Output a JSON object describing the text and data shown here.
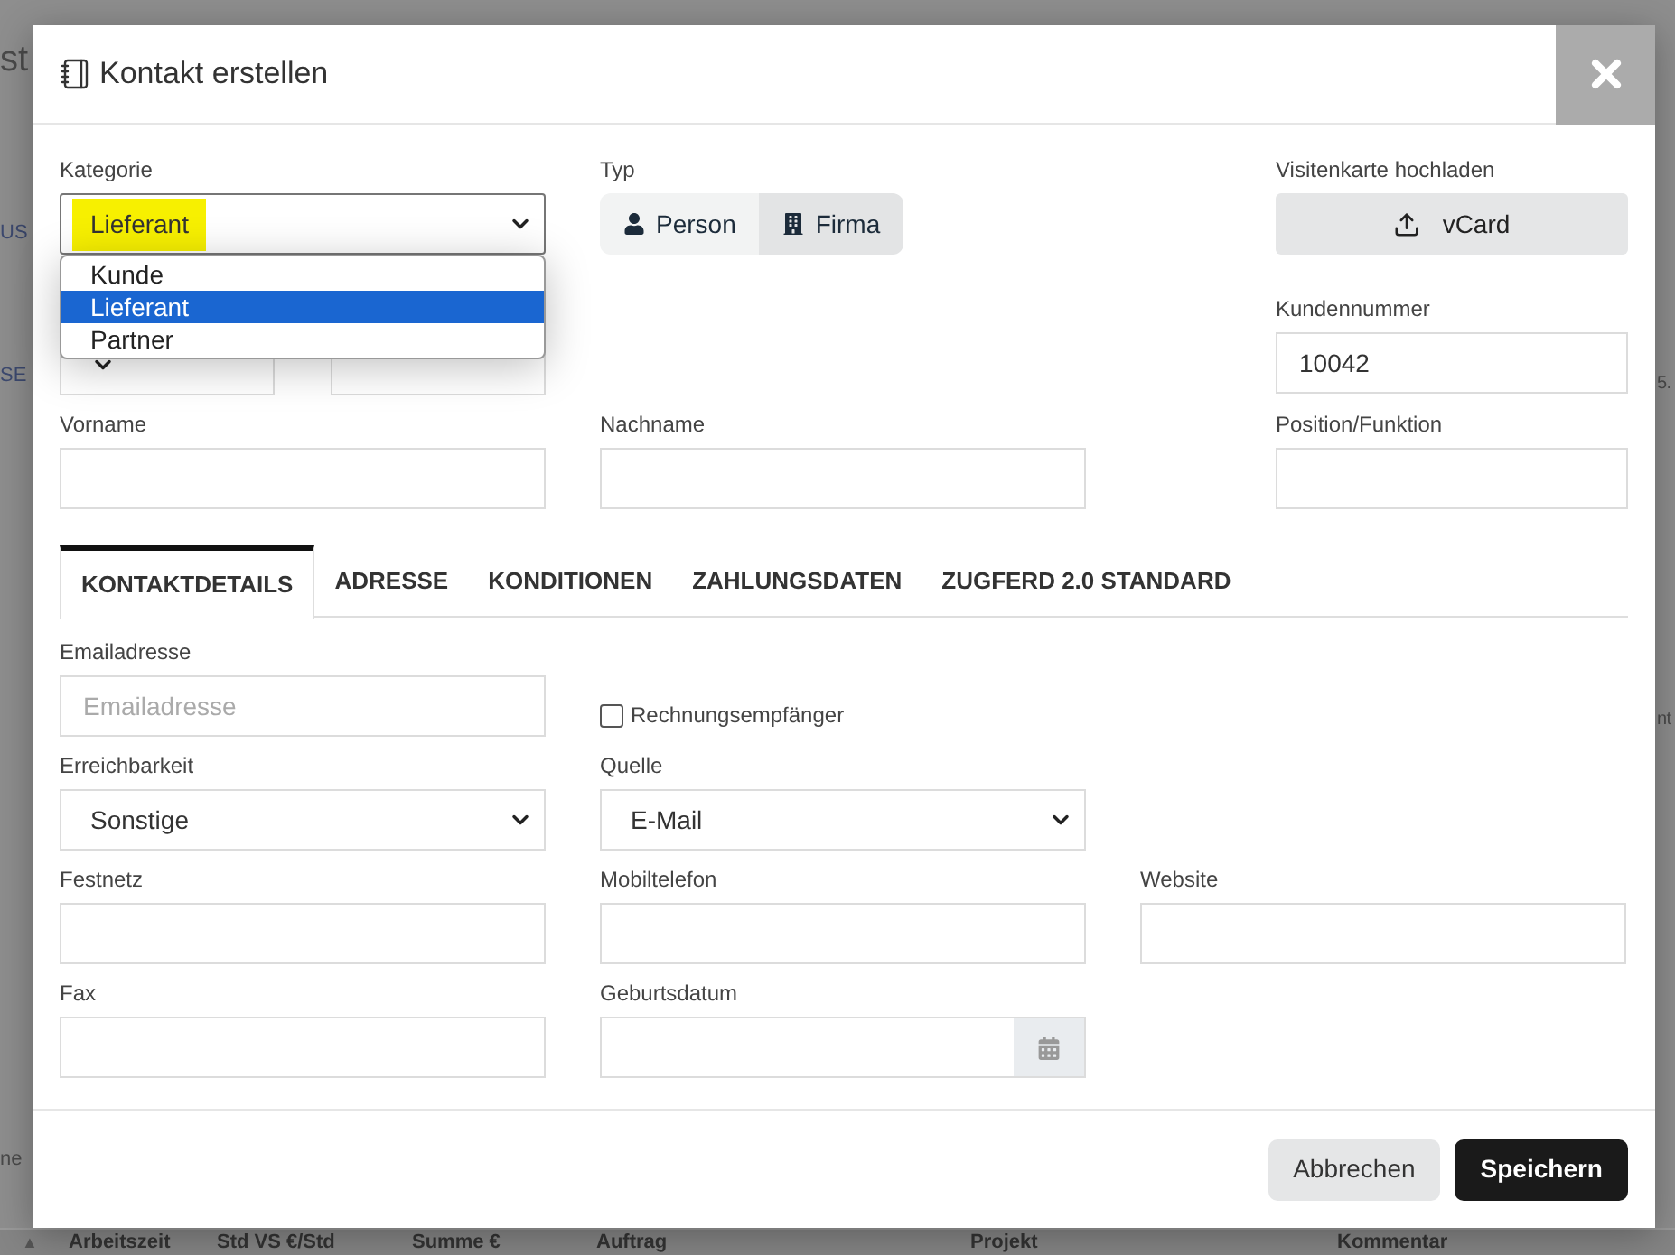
{
  "backdrop": {
    "heading_fragment": "st",
    "left_fragments": [
      "US",
      "SE",
      "ne"
    ],
    "right_fragments": [
      "5.",
      "nt"
    ],
    "sort_glyph": "▲",
    "table_columns": [
      "Arbeitszeit",
      "Std VS €/Std",
      "Summe €",
      "Auftrag",
      "Projekt",
      "Kommentar"
    ]
  },
  "dialog": {
    "title": "Kontakt erstellen",
    "category": {
      "label": "Kategorie",
      "value": "Lieferant",
      "highlighted": true,
      "expanded": true,
      "options": [
        {
          "label": "Kunde",
          "selected": false
        },
        {
          "label": "Lieferant",
          "selected": true
        },
        {
          "label": "Partner",
          "selected": false
        }
      ]
    },
    "type": {
      "label": "Typ",
      "options": [
        {
          "label": "Person",
          "kind": "person",
          "selected": false
        },
        {
          "label": "Firma",
          "kind": "company",
          "selected": true
        }
      ]
    },
    "business_card": {
      "label": "Visitenkarte hochladen",
      "button": "vCard"
    },
    "covered_fields": [
      {
        "kind": "select"
      },
      {
        "kind": "input"
      }
    ],
    "customer_number": {
      "label": "Kundennummer",
      "value": "10042"
    },
    "name_fields": [
      {
        "label": "Vorname"
      },
      {
        "label": "Nachname"
      }
    ],
    "position": {
      "label": "Position/Funktion"
    },
    "tabs": [
      {
        "label": "KONTAKTDETAILS",
        "selected": true
      },
      {
        "label": "ADRESSE",
        "selected": false
      },
      {
        "label": "KONDITIONEN",
        "selected": false
      },
      {
        "label": "ZAHLUNGSDATEN",
        "selected": false
      },
      {
        "label": "ZUGFERD 2.0 STANDARD",
        "selected": false
      }
    ],
    "detail_rows": [
      [
        {
          "kind": "input",
          "label": "Emailadresse",
          "placeholder": "Emailadresse"
        },
        {
          "kind": "checkbox",
          "label": "Rechnungsempfänger",
          "checked": false
        }
      ],
      [
        {
          "kind": "select",
          "label": "Erreichbarkeit",
          "value": "Sonstige"
        },
        {
          "kind": "select",
          "label": "Quelle",
          "value": "E-Mail"
        }
      ],
      [
        {
          "kind": "input",
          "label": "Festnetz"
        },
        {
          "kind": "input",
          "label": "Mobiltelefon"
        },
        {
          "kind": "input",
          "label": "Website"
        }
      ],
      [
        {
          "kind": "input",
          "label": "Fax"
        },
        {
          "kind": "date",
          "label": "Geburtsdatum"
        }
      ]
    ],
    "buttons": [
      {
        "label": "Abbrechen",
        "kind": "secondary"
      },
      {
        "label": "Speichern",
        "kind": "primary"
      }
    ]
  }
}
